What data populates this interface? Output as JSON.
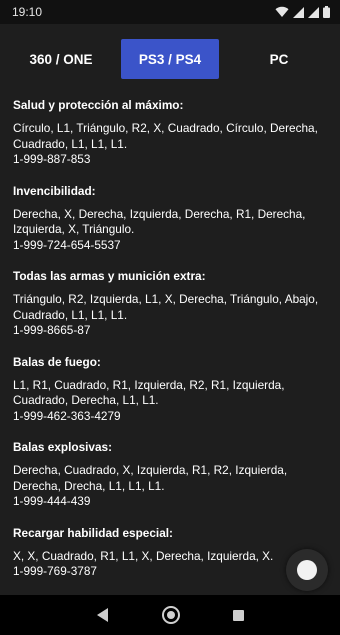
{
  "status_bar": {
    "time": "19:10",
    "icons": [
      "wifi-icon",
      "signal-icon",
      "signal-icon",
      "battery-icon"
    ]
  },
  "tabs": [
    {
      "label": "360 / ONE",
      "selected": false
    },
    {
      "label": "PS3 / PS4",
      "selected": true
    },
    {
      "label": "PC",
      "selected": false
    }
  ],
  "colors": {
    "background": "#1e1e1e",
    "selected_tab": "#3b54c9",
    "text": "#ffffff"
  },
  "entries": [
    {
      "title": "Salud y protección al máximo:",
      "code": "Círculo, L1, Triángulo, R2, X, Cuadrado, Círculo, Derecha, Cuadrado, L1, L1, L1.",
      "phone": "1-999-887-853"
    },
    {
      "title": "Invencibilidad:",
      "code": "Derecha, X, Derecha, Izquierda, Derecha, R1, Derecha, Izquierda, X, Triángulo.",
      "phone": "1-999-724-654-5537"
    },
    {
      "title": "Todas las armas y munición extra:",
      "code": "Triángulo, R2, Izquierda, L1, X, Derecha, Triángulo, Abajo, Cuadrado, L1, L1, L1.",
      "phone": "1-999-8665-87"
    },
    {
      "title": "Balas de fuego:",
      "code": "L1, R1, Cuadrado, R1, Izquierda, R2, R1, Izquierda, Cuadrado, Derecha, L1, L1.",
      "phone": "1-999-462-363-4279"
    },
    {
      "title": "Balas explosivas:",
      "code": "Derecha, Cuadrado, X, Izquierda, R1, R2, Izquierda, Derecha, Drecha, L1, L1, L1.",
      "phone": "1-999-444-439"
    },
    {
      "title": "Recargar habilidad especial:",
      "code": "X, X, Cuadrado, R1, L1, X, Derecha, Izquierda, X.",
      "phone": "1-999-769-3787"
    }
  ],
  "nav_bar": {
    "icons": [
      "back-icon",
      "home-icon",
      "recents-icon"
    ]
  }
}
